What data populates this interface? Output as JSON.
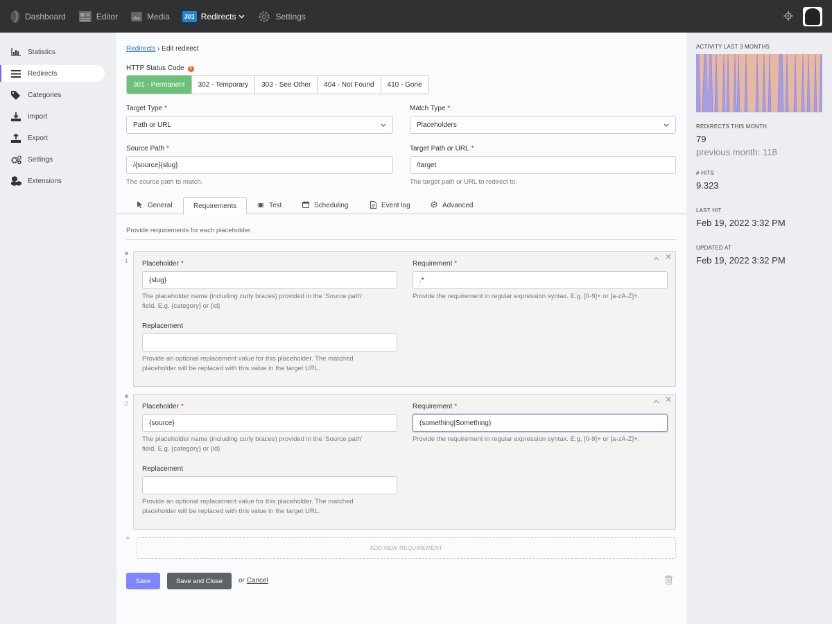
{
  "topnav": {
    "items": [
      {
        "label": "Dashboard",
        "icon": "logo-icon"
      },
      {
        "label": "Editor",
        "icon": "editor-icon"
      },
      {
        "label": "Media",
        "icon": "media-icon"
      },
      {
        "label": "Redirects",
        "icon": "redirects-301-icon",
        "badge": "301",
        "active": true
      },
      {
        "label": "Settings",
        "icon": "gear-icon"
      }
    ]
  },
  "sidebar": {
    "items": [
      {
        "label": "Statistics",
        "icon": "bar-chart-icon"
      },
      {
        "label": "Redirects",
        "icon": "list-icon",
        "active": true
      },
      {
        "label": "Categories",
        "icon": "tag-icon"
      },
      {
        "label": "Import",
        "icon": "download-icon"
      },
      {
        "label": "Export",
        "icon": "upload-icon"
      },
      {
        "label": "Settings",
        "icon": "gears-icon"
      },
      {
        "label": "Extensions",
        "icon": "cubes-icon"
      }
    ]
  },
  "breadcrumb": {
    "link": "Redirects",
    "separator": "›",
    "current": "Edit redirect"
  },
  "status": {
    "label": "HTTP Status Code",
    "help": "?",
    "options": [
      "301 - Permanent",
      "302 - Temporary",
      "303 - See Other",
      "404 - Not Found",
      "410 - Gone"
    ],
    "selected": "301 - Permanent"
  },
  "form": {
    "target_type": {
      "label": "Target Type",
      "value": "Path or URL"
    },
    "match_type": {
      "label": "Match Type",
      "value": "Placeholders"
    },
    "source_path": {
      "label": "Source Path",
      "value": "/{source}{slug}",
      "hint": "The source path to match."
    },
    "target_path": {
      "label": "Target Path or URL",
      "value": "/target",
      "hint": "The target path or URL to redirect to."
    }
  },
  "tabs": [
    {
      "label": "General",
      "icon": "cursor-icon"
    },
    {
      "label": "Requirements",
      "icon": "",
      "active": true
    },
    {
      "label": "Test",
      "icon": "bug-icon"
    },
    {
      "label": "Scheduling",
      "icon": "calendar-icon"
    },
    {
      "label": "Event log",
      "icon": "file-icon"
    },
    {
      "label": "Advanced",
      "icon": "cog-icon"
    }
  ],
  "requirements": {
    "description": "Provide requirements for each placeholder.",
    "placeholder_label": "Placeholder",
    "requirement_label": "Requirement",
    "replacement_label": "Replacement",
    "placeholder_hint_1": "The placeholder name (including curly braces) provided in the 'Source path'",
    "placeholder_hint_2": "field. E.g. {category} or {id}",
    "requirement_hint": "Provide the requirement in regular expression syntax. E.g. [0-9]+ or [a-zA-Z]+.",
    "replacement_hint_1": "Provide an optional replacement value for this placeholder. The matched",
    "replacement_hint_2": "placeholder will be replaced with this value in the target URL.",
    "items": [
      {
        "number": "1",
        "placeholder": "{slug}",
        "requirement": ".*",
        "replacement": ""
      },
      {
        "number": "2",
        "placeholder": "{source}",
        "requirement": "(something|Something)",
        "replacement": ""
      }
    ],
    "add_label": "ADD NEW REQUIREMENT"
  },
  "actions": {
    "save": "Save",
    "save_close": "Save and Close",
    "or": "or",
    "cancel": "Cancel"
  },
  "stats": {
    "activity_label": "ACTIVITY LAST 3 MONTHS",
    "this_month_label": "REDIRECTS THIS MONTH",
    "this_month_value": "79",
    "previous_month": "previous month: 118",
    "hits_label": "# HITS",
    "hits_value": "9.323",
    "last_hit_label": "LAST HIT",
    "last_hit_value": "Feb 19, 2022 3:32 PM",
    "updated_label": "UPDATED AT",
    "updated_value": "Feb 19, 2022 3:32 PM"
  },
  "colors": {
    "accent": "#7f86ff",
    "active_status": "#6cc17a",
    "topbar": "#2f3133",
    "badge": "#1d87d6",
    "spark_fill": "#e9b99f",
    "spark_line": "#8c8cf0"
  }
}
